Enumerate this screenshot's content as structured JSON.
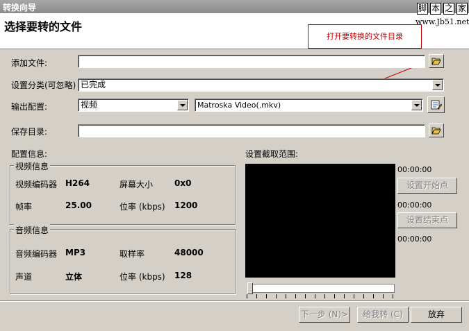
{
  "window": {
    "title": "转换向导"
  },
  "header": {
    "title": "选择要转的文件"
  },
  "watermark": {
    "chars": [
      "脚",
      "本",
      "之",
      "家"
    ],
    "url": "www.Jb51.net"
  },
  "callout": {
    "text": "打开要转换的文件目录"
  },
  "form": {
    "add_file_label": "添加文件:",
    "add_file_value": "",
    "category_label": "设置分类(可忽略)",
    "category_value": "已完成",
    "output_label": "输出配置:",
    "output_type_value": "视频",
    "output_format_value": "Matroska Video(.mkv)",
    "save_dir_label": "保存目录:",
    "save_dir_value": ""
  },
  "info": {
    "label": "配置信息:",
    "video": {
      "title": "视频信息",
      "codec_label": "视频编码器",
      "codec_value": "H264",
      "size_label": "屏幕大小",
      "size_value": "0x0",
      "fps_label": "帧率",
      "fps_value": "25.00",
      "bitrate_label": "位率 (kbps)",
      "bitrate_value": "1200"
    },
    "audio": {
      "title": "音频信息",
      "codec_label": "音频编码器",
      "codec_value": "MP3",
      "rate_label": "取样率",
      "rate_value": "48000",
      "channel_label": "声道",
      "channel_value": "立体",
      "bitrate_label": "位率 (kbps)",
      "bitrate_value": "128"
    }
  },
  "clip": {
    "label": "设置截取范围:",
    "time_current": "00:00:00",
    "time_start": "00:00:00",
    "time_end": "00:00:00",
    "set_start_label": "设置开始点",
    "set_end_label": "设置结束点"
  },
  "footer": {
    "next_label": "下一步 (N)>",
    "convert_label": "给我转 (C)",
    "cancel_label": "放弃"
  },
  "colors": {
    "callout": "#c00000",
    "video_bg": "#000000",
    "dialog_bg": "#d4d0c8"
  }
}
